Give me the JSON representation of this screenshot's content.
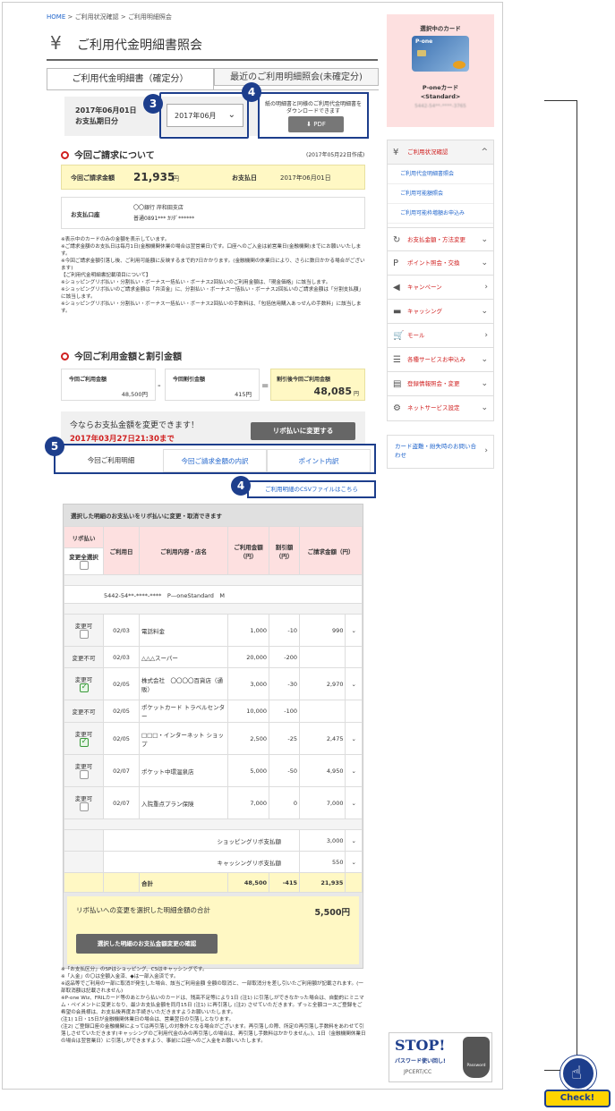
{
  "breadcrumb": {
    "home": "HOME",
    "sep1": ">",
    "item1": "ご利用状況確認",
    "sep2": ">",
    "item2": "ご利用明細照会"
  },
  "page_title": "ご利用代金明細書照会",
  "tabs": {
    "confirmed": "ご利用代金明細書（確定分）",
    "recent": "最近のご利用明細照会(未確定分)"
  },
  "date_block": {
    "line1": "2017年06月01日",
    "line2": "お支払期日分",
    "select_value": "2017年06月"
  },
  "pdf_box": {
    "text": "紙の明細書と同様のご利用代金明細書をダウンロードできます",
    "button": "PDF"
  },
  "annotations": {
    "n3": "3",
    "n4": "4",
    "n5": "5",
    "n4b": "4",
    "check": "Check!"
  },
  "billing": {
    "heading": "今回ご請求について",
    "created": "(2017年05月22日作成)",
    "amount_label": "今回ご請求金額",
    "amount": "21,935",
    "yen": "円",
    "paydate_label": "お支払日",
    "paydate": "2017年06月01日",
    "account_label": "お支払口座",
    "bank": "〇〇銀行 岸和田支店",
    "acct": "普通0891*** ｶﾘﾀﾞ******"
  },
  "notes1": [
    "※表示中のカードのみの金額を表示しています。",
    "※ご請求金額のお支払日は毎月1日(金融機関休業の場合は翌営業日)です。口座へのご入金は前営業日(金融機関)までにお願いいたします。",
    "※今回ご請求金額引落し後、ご利用可能額に反映するまで約7日かかります。(金融機関の休業日により、さらに数日かかる場合がございます)",
    "【ご利用代金明細書記載項目について】",
    "※ショッピングリボ払い・分割払い・ボーナス一括払い・ボーナス2回払いのご利用金額は、「現金価格」に該当します。",
    "※ショッピングリボ払いのご請求金額は「弁済金」に、分割払い・ボーナス一括払い・ボーナス2回払いのご請求金額は「分割支払額」に該当します。",
    "※ショッピングリボ払い・分割払い・ボーナス一括払い・ボーナス2回払いの手数料は、「包括信用購入あっせんの手数料」に該当します。"
  ],
  "discount": {
    "heading": "今回ご利用金額と割引金額",
    "use_label": "今回ご利用金額",
    "use": "48,500円",
    "minus": "-",
    "disc_label": "今回割引金額",
    "disc": "415円",
    "eq": "=",
    "after_label": "割引後今回ご利用金額",
    "after": "48,085",
    "yen": "円"
  },
  "promo": {
    "text": "今ならお支払金額を変更できます！",
    "deadline": "2017年03月27日21:30まで",
    "button": "リボ払いに変更する"
  },
  "detail_tabs": [
    "今回ご利用明細",
    "今回ご請求金額の内訳",
    "ポイント内訳"
  ],
  "csv_link": "ご利用明細のCSVファイルはこちら",
  "table": {
    "title": "選択した明細のお支払いをリボ払いに変更・取消できます",
    "headers": {
      "revo": "リボ払い",
      "select_all": "変更全選択",
      "date": "ご利用日",
      "store": "ご利用内容・店名",
      "amount": "ご利用金額（円）",
      "disc": "割引額（円）",
      "bill": "ご請求金額（円）"
    },
    "card_line": "5442-54**-****-****　P—oneStandard　M",
    "rows": [
      {
        "status": "変更可",
        "cb": "off",
        "date": "02/03",
        "store": "電話料金",
        "amount": "1,000",
        "disc": "-10",
        "bill": "990",
        "arrow": "⌄"
      },
      {
        "status": "変更不可",
        "cb": "none",
        "date": "02/03",
        "store": "△△△スーパー",
        "amount": "20,000",
        "disc": "-200",
        "bill": "",
        "arrow": ""
      },
      {
        "status": "変更可",
        "cb": "on",
        "date": "02/05",
        "store": "株式会社　〇〇〇〇百貨店（通販）",
        "amount": "3,000",
        "disc": "-30",
        "bill": "2,970",
        "arrow": "⌄"
      },
      {
        "status": "変更不可",
        "cb": "none",
        "date": "02/05",
        "store": "ポケットカード トラベルセンター",
        "amount": "10,000",
        "disc": "-100",
        "bill": "",
        "arrow": ""
      },
      {
        "status": "変更可",
        "cb": "on",
        "date": "02/05",
        "store": "□□□・インターネット ショップ",
        "amount": "2,500",
        "disc": "-25",
        "bill": "2,475",
        "arrow": "⌄"
      },
      {
        "status": "変更可",
        "cb": "off",
        "date": "02/07",
        "store": "ポケット中環温泉店",
        "amount": "5,000",
        "disc": "-50",
        "bill": "4,950",
        "arrow": "⌄"
      },
      {
        "status": "変更可",
        "cb": "off",
        "date": "02/07",
        "store": "入院重点プラン保険",
        "amount": "7,000",
        "disc": "0",
        "bill": "7,000",
        "arrow": "⌄"
      }
    ],
    "shop_fee_label": "ショッピングリボ支払額",
    "shop_fee": "3,000",
    "cash_fee_label": "キャッシングリボ支払額",
    "cash_fee": "550",
    "total_label": "合計",
    "total_amount": "48,500",
    "total_disc": "-415",
    "total_bill": "21,935",
    "selected_label": "リボ払いへの変更を選択した明細金額の合計",
    "selected_amount": "5,500円",
    "confirm_button": "選択した明細のお支払金額変更の確認"
  },
  "notes2": [
    "※「お支払区分」のSPはショッピング、CSはキャッシングです。",
    "※「入金」の〇は全額入金済、◆は一部入金済です。",
    "※返品等でご利用の一部に取消が発生した場合、該当ご利用金額 全額の取消と、一部取消分を差し引いたご利用額が記載されます。(一部取消額は記載されません)",
    "※P-one Wiz、FRILカード等のあとから払いのカードは、残高不足等により1日 (注1) に引落しができなかった場合は、自動的にミニマム・ペイメントに変更となり、最少お支払金額を同月15日 (注1) に再引落し (注2) させていただきます。ずっと全額コースご登録をご希望の会員様は、お支払後再度お手続きいただきますようお願いいたします。",
    "(注1) 1日・15日が金融機関休業日の場合は、営業翌日の引落しとなります。",
    "(注2) ご登録口座の金融機関によっては再引落しの対象外となる場合がございます。再引落しの際、所定の再引落し手数料をあわせて引落しさせていただきます(キャッシングのご利用代金のみの再引落しの場合は、再引落し手数料はかかりません。)、1日（金融機関休業日の場合は翌営業日）に引落しができますよう、事前に口座へのご入金をお願いいたします。"
  ],
  "sidebar": {
    "card_title": "選択中のカード",
    "card_brand": "P-one",
    "card_name": "P-oneカード",
    "card_std": "<Standard>",
    "card_num": "5442-54**-****-3765",
    "menu": [
      {
        "label": "ご利用状況確認",
        "icon": "¥",
        "chev": "^",
        "subs": [
          "ご利用代金明細書照会",
          "ご利用可能額照会",
          "ご利用可能枠増額お申込み"
        ]
      },
      {
        "label": "お支払金額・方法変更",
        "icon": "↻",
        "chev": "⌄"
      },
      {
        "label": "ポイント照会・交換",
        "icon": "P",
        "chev": "⌄"
      },
      {
        "label": "キャンペーン",
        "icon": "◀",
        "chev": "›"
      },
      {
        "label": "キャッシング",
        "icon": "▬",
        "chev": "⌄"
      },
      {
        "label": "モール",
        "icon": "🛒",
        "chev": "›"
      },
      {
        "label": "各種サービスお申込み",
        "icon": "☰",
        "chev": "⌄"
      },
      {
        "label": "登録情報照会・変更",
        "icon": "▤",
        "chev": "⌄"
      },
      {
        "label": "ネットサービス設定",
        "icon": "⚙",
        "chev": "⌄"
      }
    ],
    "lost": "カード盗難・紛失時のお問い合わせ",
    "stop_title": "STOP!",
    "stop_sub": "パスワード使い回し!",
    "stop_org": "JPCERT/CC",
    "stop_pw": "Password"
  },
  "colors": {
    "accent": "#1d3e8c",
    "red": "#d02020",
    "yellow": "#fff8c4",
    "pink": "#fde0e0"
  }
}
